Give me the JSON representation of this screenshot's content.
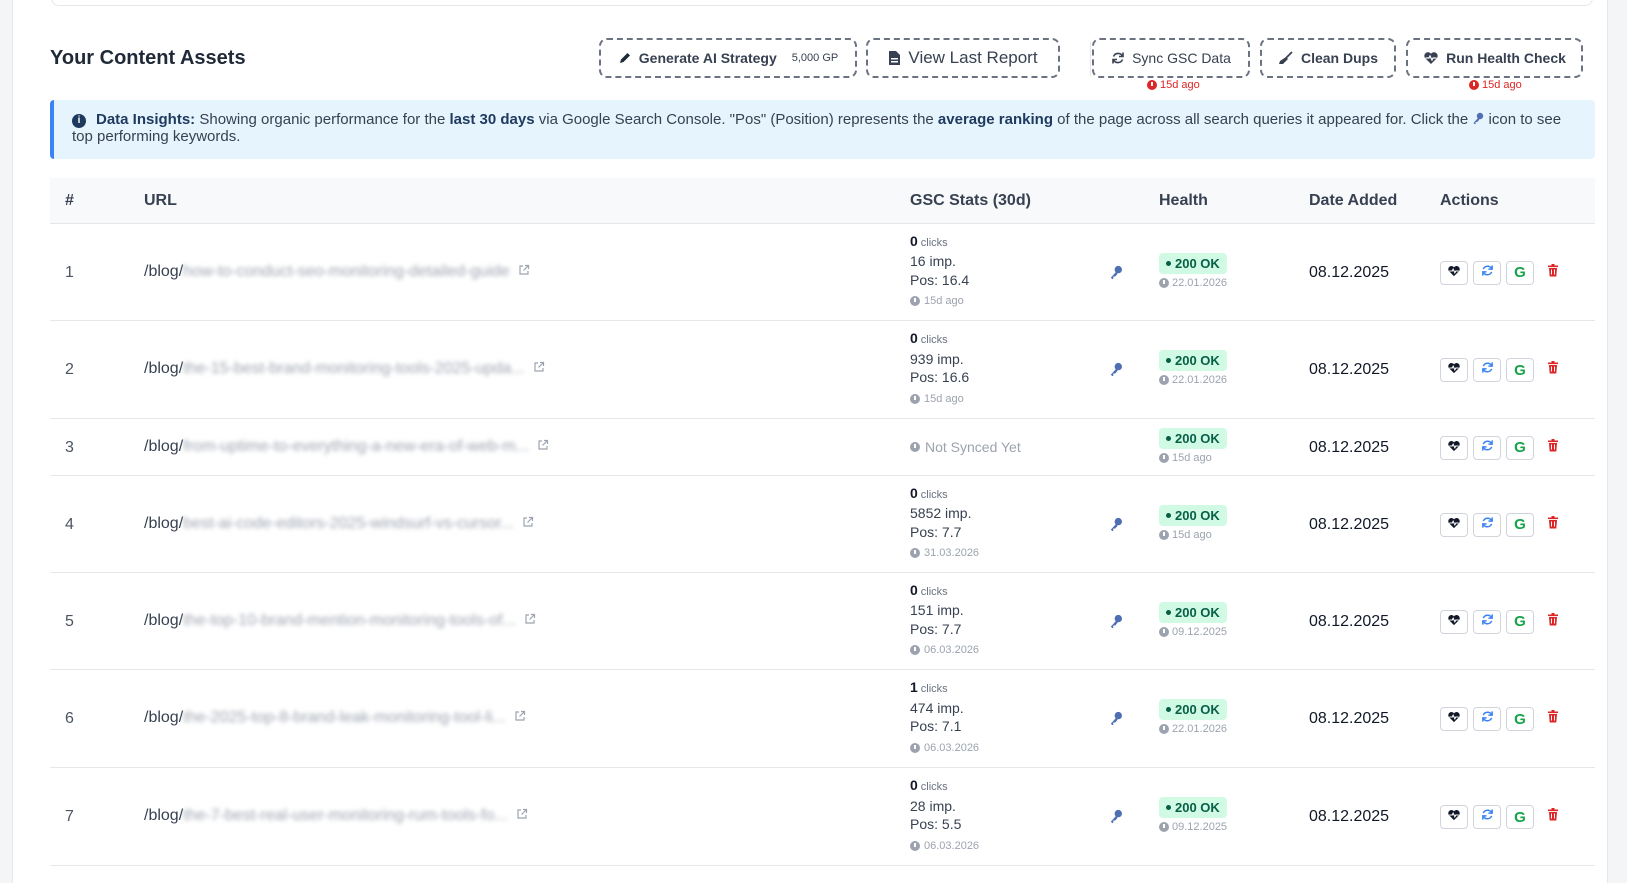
{
  "header": {
    "title": "Your Content Assets",
    "buttons": {
      "generate_label": "Generate AI Strategy",
      "generate_cost": "5,000 GP",
      "view_report_label": "View Last Report",
      "sync_label": "Sync GSC Data",
      "sync_ago": "15d ago",
      "clean_label": "Clean Dups",
      "health_label": "Run Health Check",
      "health_ago": "15d ago"
    }
  },
  "insight": {
    "lead": "Data Insights:",
    "t1": " Showing organic performance for the ",
    "b1": "last 30 days",
    "t2": " via Google Search Console. \"Pos\" (Position) represents the ",
    "b2": "average ranking",
    "t3": " of the page across all search queries it appeared for. Click the ",
    "t4": " icon to see top performing keywords."
  },
  "table": {
    "columns": [
      "#",
      "URL",
      "GSC Stats (30d)",
      "Health",
      "Date Added",
      "Actions"
    ],
    "rows": [
      {
        "num": "1",
        "url_prefix": "/blog/",
        "url_rest": "how-to-conduct-seo-monitoring-detailed-guide",
        "synced": true,
        "clicks": "0",
        "clicks_label": "clicks",
        "imp": "16 imp.",
        "pos": "Pos: 16.4",
        "stats_ago": "15d ago",
        "status": "200 OK",
        "health_date": "22.01.2026",
        "date": "08.12.2025"
      },
      {
        "num": "2",
        "url_prefix": "/blog/",
        "url_rest": "the-15-best-brand-monitoring-tools-2025-upda...",
        "synced": true,
        "clicks": "0",
        "clicks_label": "clicks",
        "imp": "939 imp.",
        "pos": "Pos: 16.6",
        "stats_ago": "15d ago",
        "status": "200 OK",
        "health_date": "22.01.2026",
        "date": "08.12.2025"
      },
      {
        "num": "3",
        "url_prefix": "/blog/",
        "url_rest": "from-uptime-to-everything-a-new-era-of-web-m...",
        "synced": false,
        "not_synced": "Not Synced Yet",
        "status": "200 OK",
        "health_date": "15d ago",
        "date": "08.12.2025"
      },
      {
        "num": "4",
        "url_prefix": "/blog/",
        "url_rest": "best-ai-code-editors-2025-windsurf-vs-cursor...",
        "synced": true,
        "clicks": "0",
        "clicks_label": "clicks",
        "imp": "5852 imp.",
        "pos": "Pos: 7.7",
        "stats_ago": "31.03.2026",
        "status": "200 OK",
        "health_date": "15d ago",
        "date": "08.12.2025"
      },
      {
        "num": "5",
        "url_prefix": "/blog/",
        "url_rest": "the-top-10-brand-mention-monitoring-tools-of...",
        "synced": true,
        "clicks": "0",
        "clicks_label": "clicks",
        "imp": "151 imp.",
        "pos": "Pos: 7.7",
        "stats_ago": "06.03.2026",
        "status": "200 OK",
        "health_date": "09.12.2025",
        "date": "08.12.2025"
      },
      {
        "num": "6",
        "url_prefix": "/blog/",
        "url_rest": "the-2025-top-8-brand-leak-monitoring-tool-li...",
        "synced": true,
        "clicks": "1",
        "clicks_label": "clicks",
        "imp": "474 imp.",
        "pos": "Pos: 7.1",
        "stats_ago": "06.03.2026",
        "status": "200 OK",
        "health_date": "22.01.2026",
        "date": "08.12.2025"
      },
      {
        "num": "7",
        "url_prefix": "/blog/",
        "url_rest": "the-7-best-real-user-monitoring-rum-tools-fo...",
        "synced": true,
        "clicks": "0",
        "clicks_label": "clicks",
        "imp": "28 imp.",
        "pos": "Pos: 5.5",
        "stats_ago": "06.03.2026",
        "status": "200 OK",
        "health_date": "09.12.2025",
        "date": "08.12.2025"
      }
    ]
  },
  "colors": {
    "accent": "#3b82f6",
    "ok_bg": "#d1fae5",
    "ok_text": "#065f46",
    "danger": "#dc2626",
    "google": "#16a34a"
  }
}
